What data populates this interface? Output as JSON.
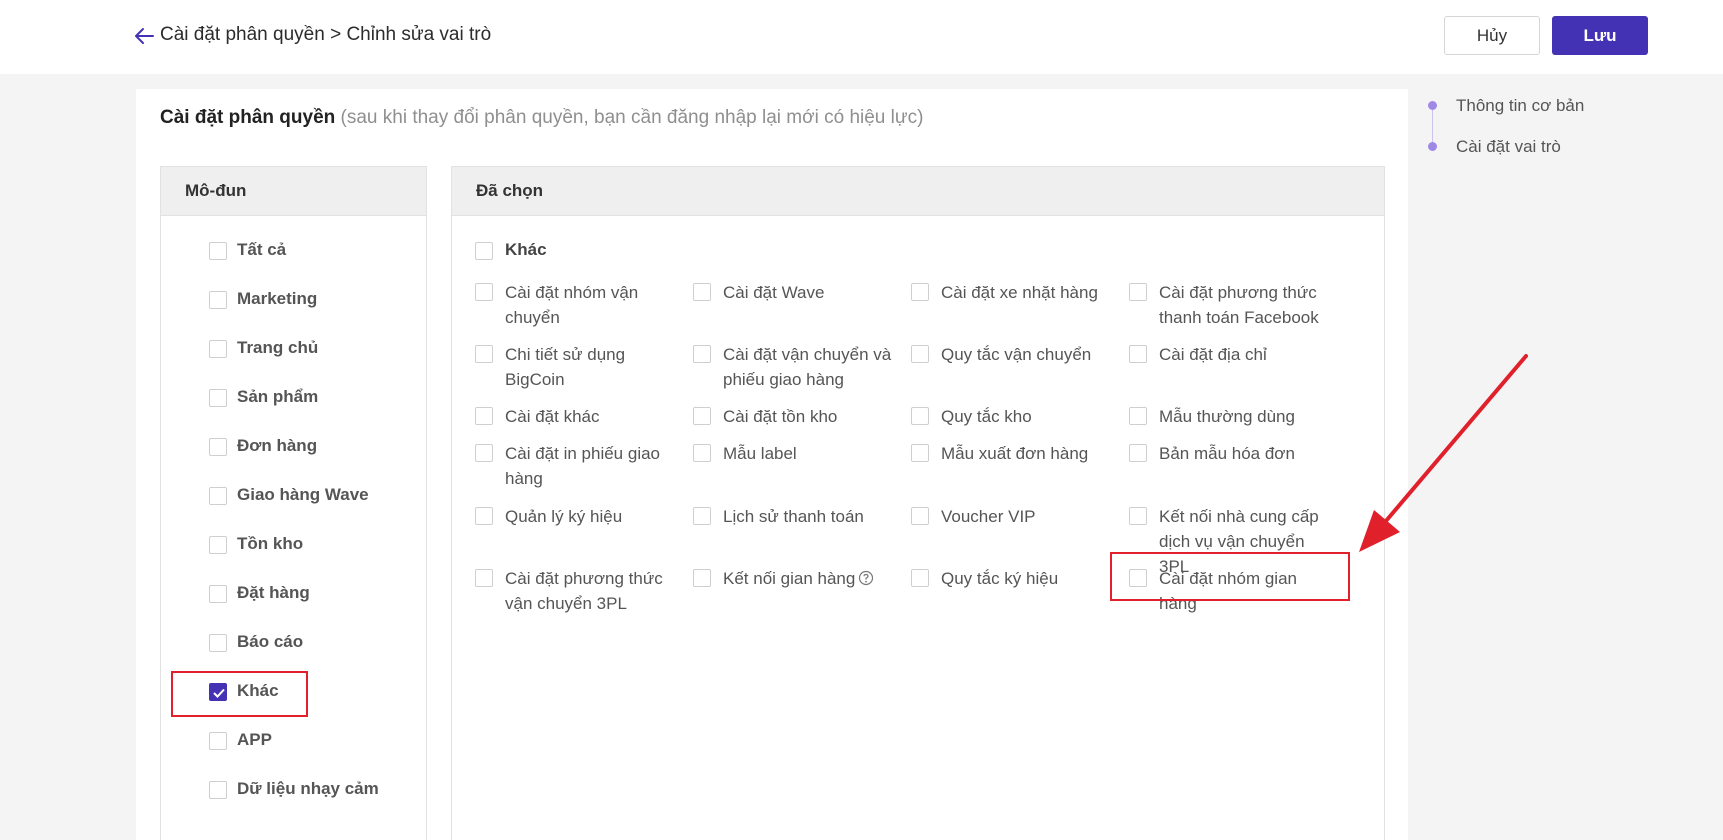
{
  "header": {
    "breadcrumb": "Cài đặt phân quyền > Chỉnh sửa vai trò",
    "cancel_label": "Hủy",
    "save_label": "Lưu"
  },
  "section": {
    "title": "Cài đặt phân quyền",
    "note": "(sau khi thay đổi phân quyền, bạn cần đăng nhập lại mới có hiệu lực)"
  },
  "modules": {
    "header": "Mô-đun",
    "items": [
      {
        "label": "Tất cả",
        "checked": false
      },
      {
        "label": "Marketing",
        "checked": false
      },
      {
        "label": "Trang chủ",
        "checked": false
      },
      {
        "label": "Sản phẩm",
        "checked": false
      },
      {
        "label": "Đơn hàng",
        "checked": false
      },
      {
        "label": "Giao hàng Wave",
        "checked": false
      },
      {
        "label": "Tồn kho",
        "checked": false
      },
      {
        "label": "Đặt hàng",
        "checked": false
      },
      {
        "label": "Báo cáo",
        "checked": false
      },
      {
        "label": "Khác",
        "checked": true
      },
      {
        "label": "APP",
        "checked": false
      },
      {
        "label": "Dữ liệu nhạy cảm",
        "checked": false
      }
    ]
  },
  "selected": {
    "header": "Đã chọn",
    "group_label": "Khác",
    "permissions": [
      "Cài đặt nhóm vận chuyển",
      "Cài đặt Wave",
      "Cài đặt xe nhặt hàng",
      "Cài đặt phương thức thanh toán Facebook",
      "Chi tiết sử dụng BigCoin",
      "Cài đặt vận chuyển và phiếu giao hàng",
      "Quy tắc vận chuyển",
      "Cài đặt địa chỉ",
      "Cài đặt khác",
      "Cài đặt tồn kho",
      "Quy tắc kho",
      "Mẫu thường dùng",
      "Cài đặt in phiếu giao hàng",
      "Mẫu label",
      "Mẫu xuất đơn hàng",
      "Bản mẫu hóa đơn",
      "Quản lý ký hiệu",
      "Lịch sử thanh toán",
      "Voucher VIP",
      "Kết nối nhà cung cấp dịch vụ vận chuyển 3PL",
      "Cài đặt phương thức vận chuyển 3PL",
      "Kết nối gian hàng",
      "Quy tắc ký hiệu",
      "Cài đặt nhóm gian hàng"
    ]
  },
  "steps": [
    "Thông tin cơ bản",
    "Cài đặt vai trò"
  ],
  "colors": {
    "accent": "#4332b3",
    "highlight": "#e0202b",
    "step_dot": "#a088e6"
  }
}
